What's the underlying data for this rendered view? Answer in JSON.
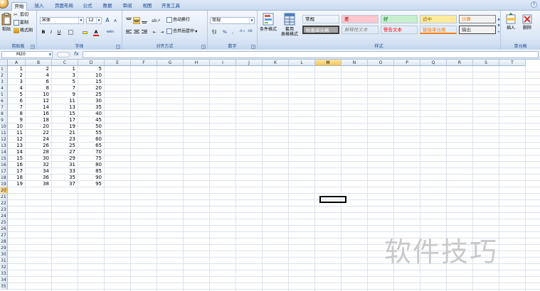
{
  "tabs": [
    "开始",
    "插入",
    "页面布局",
    "公式",
    "数据",
    "审阅",
    "视图",
    "开发工具"
  ],
  "active_tab": "开始",
  "clipboard": {
    "paste": "粘贴",
    "cut": "剪切",
    "copy": "复制",
    "format_painter": "格式刷",
    "label": "剪贴板"
  },
  "font": {
    "name": "宋体",
    "size": "12",
    "bold": "B",
    "italic": "I",
    "underline": "U",
    "grow": "A",
    "shrink": "A",
    "color_a": "A",
    "wen": "wén",
    "label": "字体"
  },
  "alignment": {
    "wrap": "自动换行",
    "merge": "合并后居中",
    "label": "对齐方式"
  },
  "number": {
    "format": "常规",
    "percent": "%",
    "comma": ",",
    "label": "数字"
  },
  "styles": {
    "conditional": "条件格式",
    "table_format_1": "套用",
    "table_format_2": "表格格式",
    "cells": [
      {
        "text": "常规",
        "bg": "#ffffff",
        "fg": "#000000"
      },
      {
        "text": "差",
        "bg": "#ffc7ce",
        "fg": "#9c0006"
      },
      {
        "text": "好",
        "bg": "#c6efce",
        "fg": "#006100"
      },
      {
        "text": "适中",
        "bg": "#ffeb9c",
        "fg": "#9c6500"
      },
      {
        "text": "计算",
        "bg": "#f2f2f2",
        "fg": "#fa7d00"
      },
      {
        "text": "检查单元格",
        "bg": "#a5a5a5",
        "fg": "#ffffff"
      },
      {
        "text": "解释性文本",
        "bg": "#ffffff",
        "fg": "#7f7f7f"
      },
      {
        "text": "警告文本",
        "bg": "#ffffff",
        "fg": "#ff0000"
      },
      {
        "text": "链接单元格",
        "bg": "#ffffff",
        "fg": "#fa7d00"
      },
      {
        "text": "输出",
        "bg": "#f2f2f2",
        "fg": "#3f3f3f"
      }
    ],
    "label": "样式"
  },
  "cells_group": {
    "insert": "插入",
    "delete": "删除",
    "label": "单元格"
  },
  "formula_bar": {
    "name_box": "M20",
    "fx": "fx",
    "value": ""
  },
  "columns": [
    "A",
    "B",
    "C",
    "D",
    "E",
    "F",
    "G",
    "H",
    "I",
    "J",
    "K",
    "L",
    "M",
    "N",
    "O",
    "P",
    "Q",
    "R",
    "S",
    "T"
  ],
  "selected_column": "M",
  "rows": [
    "1",
    "2",
    "3",
    "4",
    "5",
    "6",
    "7",
    "8",
    "9",
    "10",
    "11",
    "12",
    "13",
    "14",
    "15",
    "16",
    "17",
    "18",
    "19",
    "20",
    "21",
    "22",
    "23",
    "24",
    "25",
    "26",
    "27",
    "28",
    "29",
    "30",
    "31",
    "32",
    "33",
    "34",
    "35"
  ],
  "selected_row": "20",
  "data": [
    [
      "1",
      "2",
      "1",
      "5"
    ],
    [
      "2",
      "4",
      "3",
      "10"
    ],
    [
      "3",
      "6",
      "5",
      "15"
    ],
    [
      "4",
      "8",
      "7",
      "20"
    ],
    [
      "5",
      "10",
      "9",
      "25"
    ],
    [
      "6",
      "12",
      "11",
      "30"
    ],
    [
      "7",
      "14",
      "13",
      "35"
    ],
    [
      "8",
      "16",
      "15",
      "40"
    ],
    [
      "9",
      "18",
      "17",
      "45"
    ],
    [
      "10",
      "20",
      "19",
      "50"
    ],
    [
      "11",
      "22",
      "21",
      "55"
    ],
    [
      "12",
      "24",
      "23",
      "60"
    ],
    [
      "13",
      "26",
      "25",
      "65"
    ],
    [
      "14",
      "28",
      "27",
      "70"
    ],
    [
      "15",
      "30",
      "29",
      "75"
    ],
    [
      "16",
      "32",
      "31",
      "80"
    ],
    [
      "17",
      "34",
      "33",
      "85"
    ],
    [
      "18",
      "36",
      "35",
      "90"
    ],
    [
      "19",
      "38",
      "37",
      "95"
    ]
  ],
  "watermark": "软件技巧"
}
